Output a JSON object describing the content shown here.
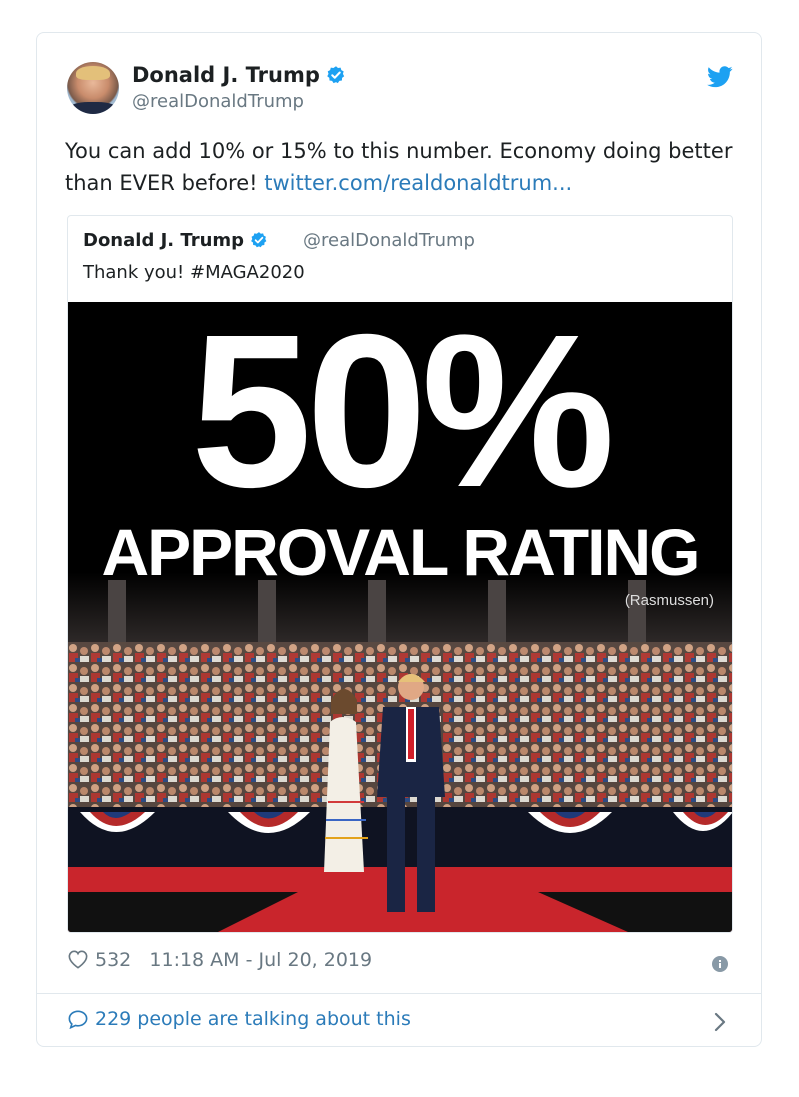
{
  "tweet": {
    "author_name": "Donald J. Trump",
    "author_handle": "@realDonaldTrump",
    "text": "You can add 10% or 15% to this number. Economy doing better than EVER before!",
    "link_text": "twitter.com/realdonaldtrum...",
    "likes": "532",
    "timestamp": "11:18 AM - Jul 20, 2019",
    "talking": "229 people are talking about this"
  },
  "quoted": {
    "author_name": "Donald J. Trump",
    "author_handle": "@realDonaldTrump",
    "text": "Thank you! #MAGA2020",
    "image_headline": "50%",
    "image_subheadline": "APPROVAL RATING",
    "image_source": "(Rasmussen)"
  },
  "colors": {
    "link": "#2b7bb9",
    "verified": "#1da1f2",
    "muted": "#697882",
    "border": "#e1e8ed"
  },
  "icons": {
    "verified": "verified-badge-icon",
    "bird": "twitter-bird-icon",
    "heart": "heart-icon",
    "info": "info-icon",
    "bubble": "speech-bubble-icon",
    "chevron": "chevron-right-icon"
  }
}
